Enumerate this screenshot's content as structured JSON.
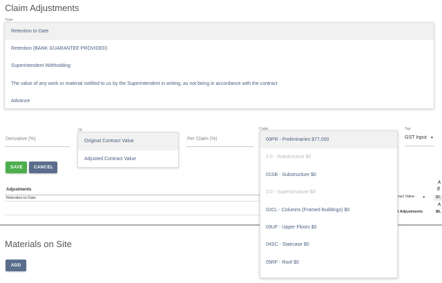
{
  "claim_adjustments": {
    "title": "Claim Adjustments",
    "type_label": "Type",
    "type_options": [
      "Retention to Date",
      "Retention (BANK GUARANTEE PROVIDED)",
      "Superintendent Withholding",
      "The value of any work or material notified to us by the Superintendent in writing, as not being in accordance with the contract",
      "Advance"
    ],
    "type_selected_index": 0
  },
  "form": {
    "derivative_placeholder": "Derivative (%)",
    "of_label": "Of",
    "of_options": [
      "Original Contract Value",
      "Adjusted Contract Value"
    ],
    "of_selected_index": 0,
    "per_claim_placeholder": "Per Claim (%)",
    "code_label": "Code",
    "code_options": [
      {
        "label": "00PR - Preliminaries $77,000",
        "disabled": false
      },
      {
        "label": "2.0 - Substructure $0",
        "disabled": true
      },
      {
        "label": "01SB - Substructure $0",
        "disabled": false
      },
      {
        "label": "3.0 - Superstructure $0",
        "disabled": true
      },
      {
        "label": "02CL - Columns (Framed Buildings) $0",
        "disabled": false
      },
      {
        "label": "03UF - Upper Floors $0",
        "disabled": false
      },
      {
        "label": "04SC - Staircase $0",
        "disabled": false
      },
      {
        "label": "05RF - Roof $0",
        "disabled": false
      }
    ],
    "code_selected_index": 0,
    "tax_label": "Tax",
    "tax_value": "GST Input",
    "tax_arrow": "▼",
    "save_label": "SAVE",
    "cancel_label": "CANCEL"
  },
  "adjustments_table": {
    "header": "Adjustments",
    "rows": [
      "Retention to Date"
    ],
    "right_header_fragment_1": "A",
    "right_header_fragment_2": "(t",
    "right_select_text": "ract Value",
    "right_select_arrow": "▼",
    "right_value_1": "$6,",
    "right_fragment_a": "A",
    "right_total_label": "l Adjustments",
    "right_total_value": "$6,"
  },
  "materials": {
    "title": "Materials on Site",
    "add_label": "ADD"
  }
}
